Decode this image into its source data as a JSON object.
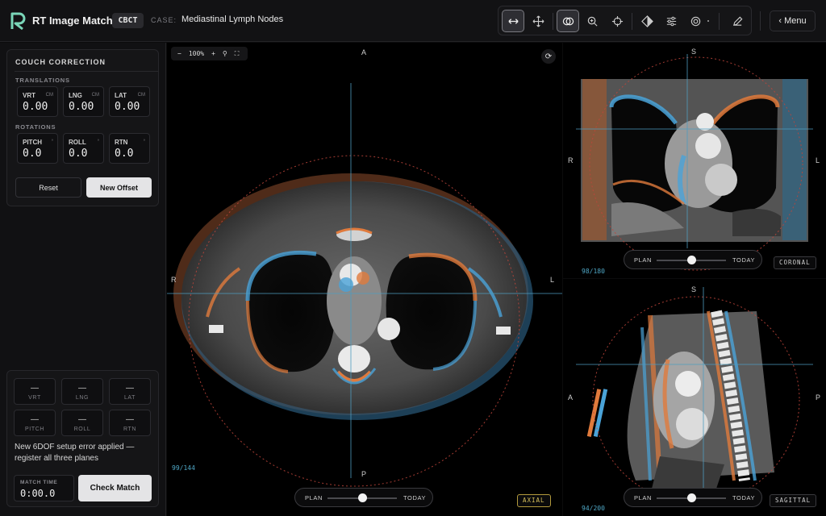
{
  "app": {
    "title": "RT Image Match",
    "mode": "CBCT",
    "case_label": "CASE:",
    "case_name": "Mediastinal Lymph Nodes"
  },
  "toolbar": {
    "tools": [
      {
        "id": "window-level",
        "icon": "horizontal-arrows-icon",
        "active": true
      },
      {
        "id": "pan",
        "icon": "move-arrows-icon",
        "active": false
      },
      {
        "id": "overlay",
        "icon": "overlay-circles-icon",
        "active": true
      },
      {
        "id": "zoom",
        "icon": "magnifier-icon",
        "active": false
      },
      {
        "id": "crosshair",
        "icon": "crosshair-icon",
        "active": false
      },
      {
        "id": "contrast",
        "icon": "contrast-diamond-icon",
        "active": false
      },
      {
        "id": "sliders",
        "icon": "sliders-icon",
        "active": false
      },
      {
        "id": "target",
        "icon": "target-icon",
        "active": false
      },
      {
        "id": "annotate",
        "icon": "pencil-icon",
        "active": false
      }
    ],
    "menu_label": "Menu"
  },
  "couch": {
    "title": "COUCH CORRECTION",
    "translations_label": "TRANSLATIONS",
    "rotations_label": "ROTATIONS",
    "translations": [
      {
        "label": "VRT",
        "unit": "CM",
        "value": "0.00"
      },
      {
        "label": "LNG",
        "unit": "CM",
        "value": "0.00"
      },
      {
        "label": "LAT",
        "unit": "CM",
        "value": "0.00"
      }
    ],
    "rotations": [
      {
        "label": "PITCH",
        "unit": "°",
        "value": "0.0"
      },
      {
        "label": "ROLL",
        "unit": "°",
        "value": "0.0"
      },
      {
        "label": "RTN",
        "unit": "°",
        "value": "0.0"
      }
    ],
    "reset_label": "Reset",
    "new_offset_label": "New Offset"
  },
  "setup_error": {
    "cells": [
      {
        "value": "—",
        "label": "VRT"
      },
      {
        "value": "—",
        "label": "LNG"
      },
      {
        "value": "—",
        "label": "LAT"
      },
      {
        "value": "—",
        "label": "PITCH"
      },
      {
        "value": "—",
        "label": "ROLL"
      },
      {
        "value": "—",
        "label": "RTN"
      }
    ],
    "message": "New 6DOF setup error applied — register all three planes",
    "timer_label": "MATCH TIME",
    "timer_value": "0:00.0",
    "check_label": "Check Match"
  },
  "axial": {
    "zoom": "100%",
    "orient": {
      "top": "A",
      "bottom": "P",
      "left": "R",
      "right": "L"
    },
    "slice": "99/144",
    "name": "AXIAL",
    "blend_left": "PLAN",
    "blend_right": "TODAY",
    "blend_value": 0.5
  },
  "coronal": {
    "orient": {
      "top": "S",
      "bottom": "",
      "left": "R",
      "right": "L"
    },
    "slice": "98/180",
    "name": "CORONAL",
    "blend_left": "PLAN",
    "blend_right": "TODAY",
    "blend_value": 0.5
  },
  "sagittal": {
    "orient": {
      "top": "S",
      "bottom": "",
      "left": "A",
      "right": "P"
    },
    "slice": "94/200",
    "name": "SAGITTAL",
    "blend_left": "PLAN",
    "blend_right": "TODAY",
    "blend_value": 0.5
  },
  "colors": {
    "plan": "#e07a3c",
    "today": "#4aa3d8",
    "crosshair": "#4e9cbf",
    "contour": "#c0453b"
  }
}
